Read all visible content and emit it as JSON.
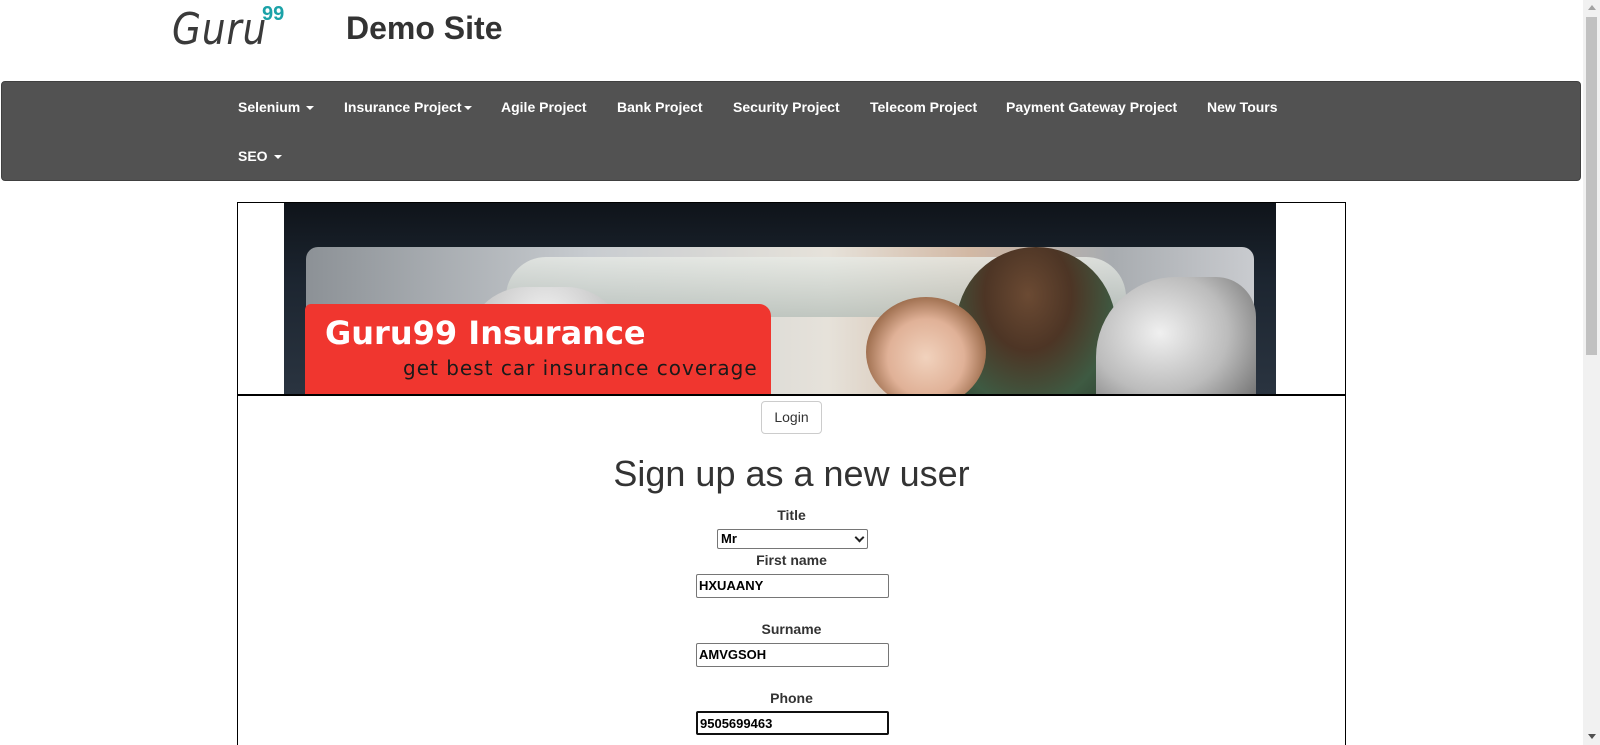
{
  "header": {
    "logo_text": "Guru",
    "logo_sup": "99",
    "site_title": "Demo Site"
  },
  "nav": {
    "items": [
      {
        "label": "Selenium",
        "dropdown": true
      },
      {
        "label": "Insurance Project",
        "dropdown": true
      },
      {
        "label": "Agile Project",
        "dropdown": false
      },
      {
        "label": "Bank Project",
        "dropdown": false
      },
      {
        "label": "Security Project",
        "dropdown": false
      },
      {
        "label": "Telecom Project",
        "dropdown": false
      },
      {
        "label": "Payment Gateway Project",
        "dropdown": false
      },
      {
        "label": "New Tours",
        "dropdown": false
      },
      {
        "label": "SEO",
        "dropdown": true
      }
    ]
  },
  "banner": {
    "title": "Guru99 Insurance",
    "subtitle": "get best car insurance coverage"
  },
  "login_label": "Login",
  "form": {
    "heading": "Sign up as a new user",
    "title_label": "Title",
    "title_value": "Mr",
    "first_name_label": "First name",
    "first_name_value": "HXUAANY",
    "surname_label": "Surname",
    "surname_value": "AMVGSOH",
    "phone_label": "Phone",
    "phone_value": "9505699463"
  },
  "colors": {
    "navbar_bg": "#525252",
    "logo_accent": "#1ba2a8",
    "promo_red": "#f0362f"
  }
}
